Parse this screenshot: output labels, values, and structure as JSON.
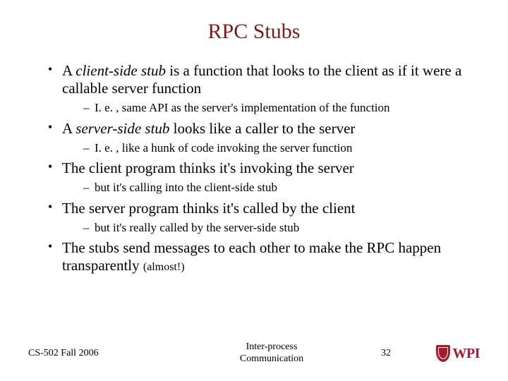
{
  "title": "RPC Stubs",
  "bullets": {
    "b1_pre": "A ",
    "b1_em": "client-side stub",
    "b1_post": " is a function that looks to the client as if it were a callable server function",
    "b1_sub": "I. e. , same API as the server's implementation of the function",
    "b2_pre": "A ",
    "b2_em": "server-side stub",
    "b2_post": " looks like a caller to the server",
    "b2_sub": "I. e. , like a hunk of code invoking the server function",
    "b3": "The client program thinks it's invoking the server",
    "b3_sub": "but it's calling into the client-side stub",
    "b4": "The server program thinks it's called by the client",
    "b4_sub": "but it's really called by the server-side stub",
    "b5_main": "The stubs send messages to each other to make the RPC happen transparently ",
    "b5_small": "(almost!)"
  },
  "footer": {
    "course": "CS-502 Fall 2006",
    "topic_line1": "Inter-process",
    "topic_line2": "Communication",
    "page": "32",
    "logo_text": "WPI"
  }
}
